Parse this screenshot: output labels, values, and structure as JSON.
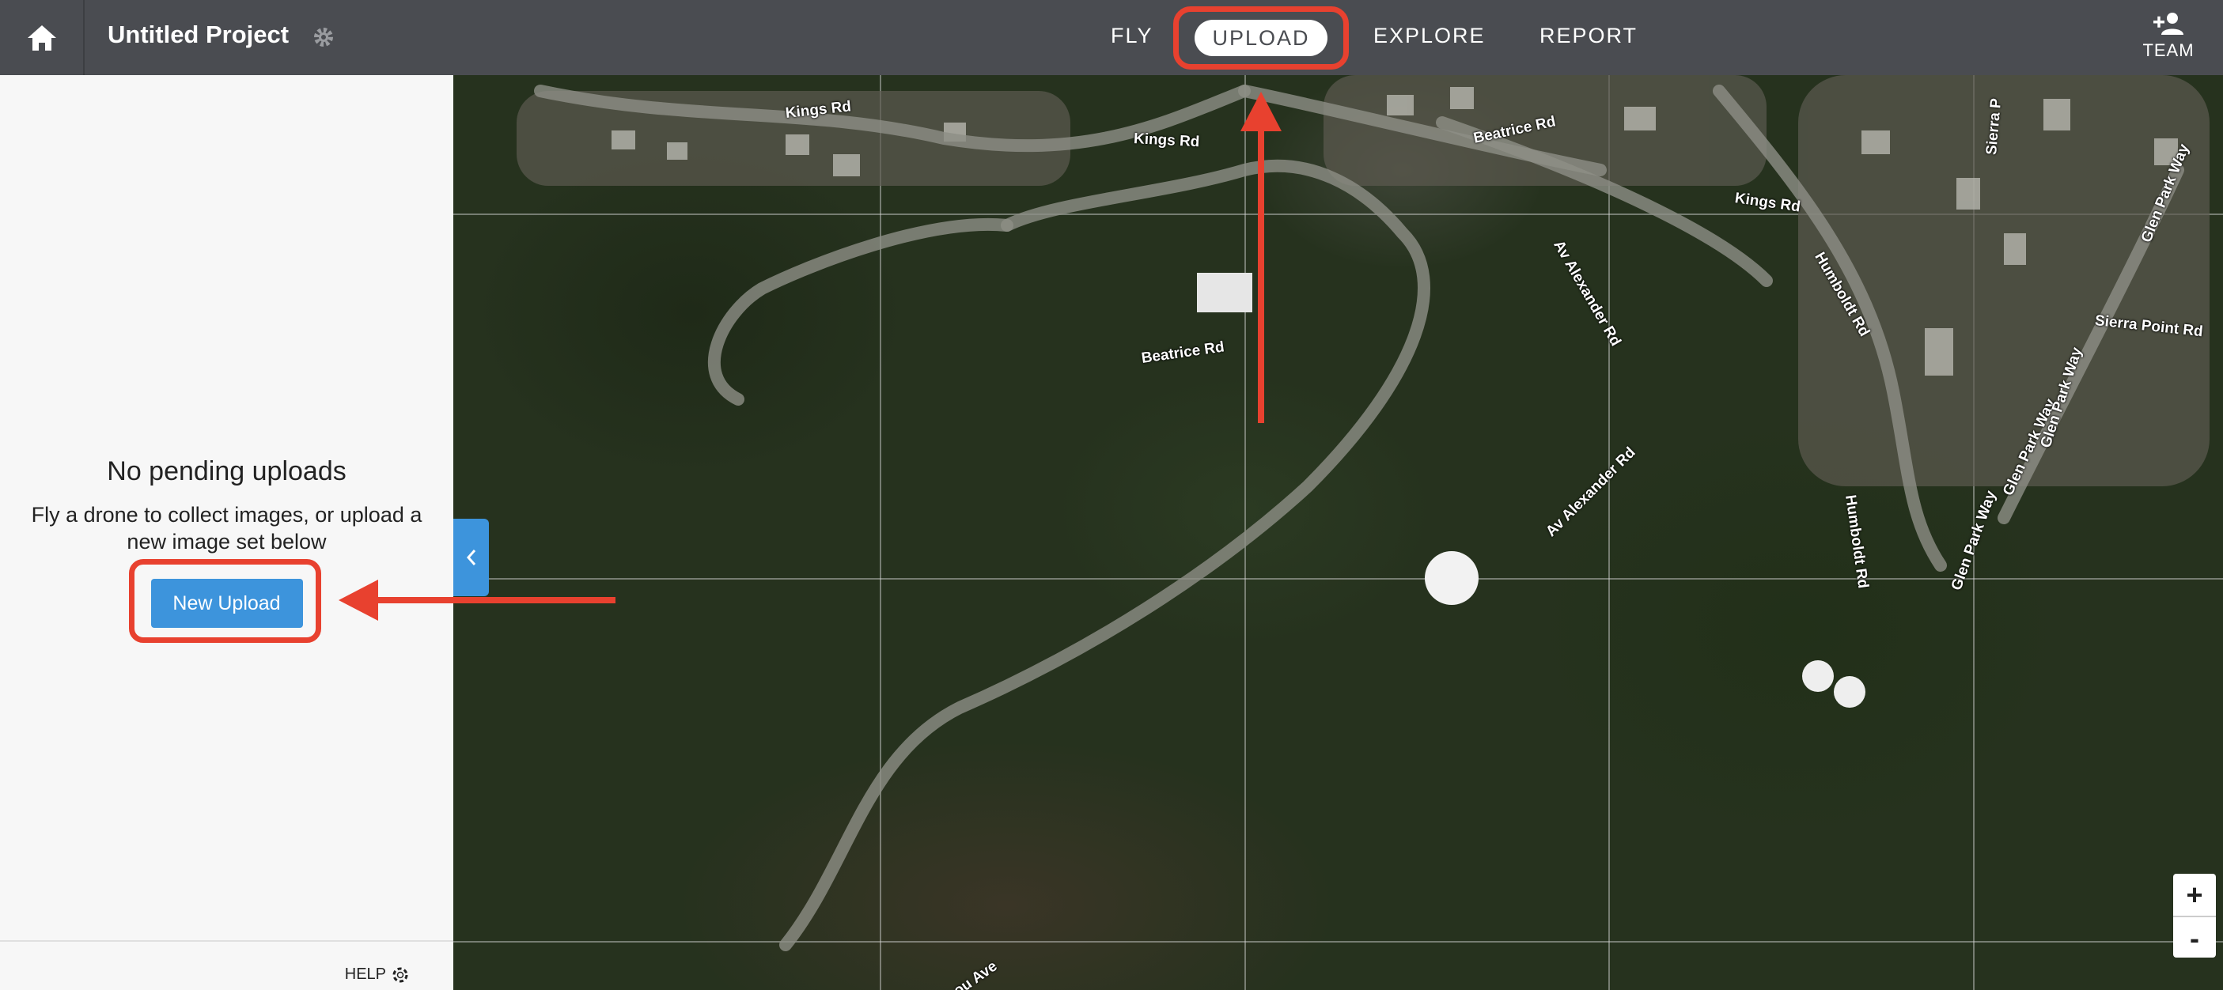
{
  "header": {
    "project_title": "Untitled Project",
    "tabs": [
      "FLY",
      "UPLOAD",
      "EXPLORE",
      "REPORT"
    ],
    "active_tab": "UPLOAD",
    "team_label": "TEAM"
  },
  "sidebar": {
    "empty_title": "No pending uploads",
    "empty_description": "Fly a drone to collect images, or upload a new image set below",
    "new_upload_label": "New Upload",
    "help_label": "HELP"
  },
  "map": {
    "street_labels": [
      "Kings Rd",
      "Kings Rd",
      "Kings Rd",
      "Beatrice Rd",
      "Beatrice Rd",
      "Av Alexander Rd",
      "Av Alexander Rd",
      "Humboldt Rd",
      "Humboldt Rd",
      "Sierra Point Rd",
      "Glen Park Way",
      "Glen Park Way",
      "Glen Park Way",
      "Sierra P",
      "Glen Park Way",
      "ou Ave"
    ],
    "zoom_in": "+",
    "zoom_out": "-"
  },
  "colors": {
    "topbar": "#4a4c51",
    "accent": "#3d94dc",
    "annotation": "#e8412f"
  }
}
